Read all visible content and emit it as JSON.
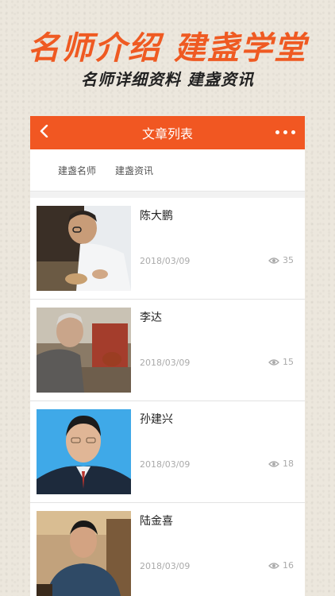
{
  "promo": {
    "title": "名师介绍 建盏学堂",
    "subtitle": "名师详细资料 建盏资讯"
  },
  "navbar": {
    "title": "文章列表",
    "back_icon": "chevron-left-icon",
    "more_icon": "more-dots-icon",
    "background": "#f15722"
  },
  "tabs": [
    {
      "label": "建盏名师"
    },
    {
      "label": "建盏资讯"
    }
  ],
  "articles": [
    {
      "name": "陈大鹏",
      "date": "2018/03/09",
      "views": "35"
    },
    {
      "name": "李达",
      "date": "2018/03/09",
      "views": "15"
    },
    {
      "name": "孙建兴",
      "date": "2018/03/09",
      "views": "18"
    },
    {
      "name": "陆金喜",
      "date": "2018/03/09",
      "views": "16"
    }
  ]
}
